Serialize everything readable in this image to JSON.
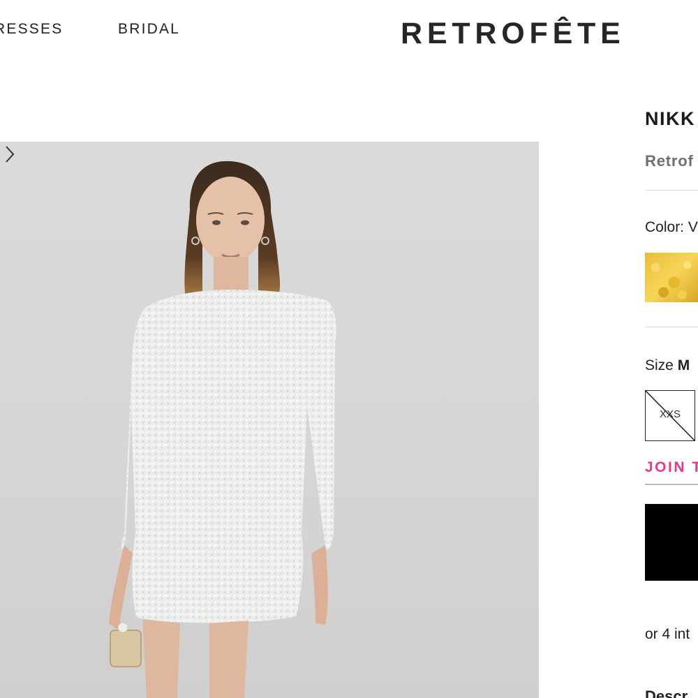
{
  "header": {
    "nav": [
      "RESSES",
      "BRIDAL"
    ],
    "logo": "RETROFÊTE"
  },
  "product": {
    "title": "NIKK",
    "brand": "Retrof",
    "color_label": "Color: V",
    "size_label_prefix": "Size",
    "size_label_value": "M",
    "sizes": [
      {
        "label": "XXS",
        "available": false
      }
    ],
    "join_link": "JOIN T",
    "installments": "or 4 int",
    "description_heading": "Descr"
  },
  "colors": {
    "accent": "#e8388e",
    "button": "#000000",
    "swatch": "#e9bd35"
  },
  "icons": {
    "next": "chevron-right-icon"
  }
}
